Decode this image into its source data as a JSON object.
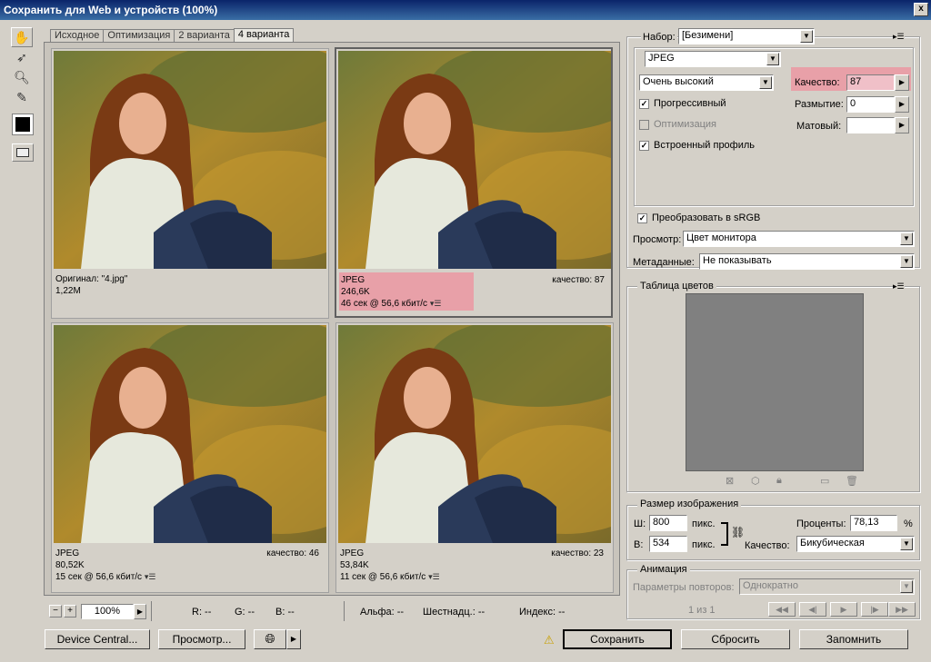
{
  "window": {
    "title": "Сохранить для Web и устройств (100%)",
    "close": "x"
  },
  "tabs": [
    "Исходное",
    "Оптимизация",
    "2 варианта",
    "4 варианта"
  ],
  "panes": [
    {
      "line1": "Оригинал: \"4.jpg\"",
      "line2": "1,22M",
      "line3": "",
      "quality": ""
    },
    {
      "line1": "JPEG",
      "line2": "246,6K",
      "line3": "46 сек @ 56,6 кбит/с",
      "quality": "качество: 87"
    },
    {
      "line1": "JPEG",
      "line2": "80,52K",
      "line3": "15 сек @ 56,6 кбит/с",
      "quality": "качество: 46"
    },
    {
      "line1": "JPEG",
      "line2": "53,84K",
      "line3": "11 сек @ 56,6 кбит/с",
      "quality": "качество: 23"
    }
  ],
  "settings": {
    "preset_label": "Набор:",
    "preset_value": "[Безимени]",
    "format": "JPEG",
    "compression": "Очень высокий",
    "quality_label": "Качество:",
    "quality_value": "87",
    "progressive": "Прогрессивный",
    "blur_label": "Размытие:",
    "blur_value": "0",
    "optimized": "Оптимизация",
    "matte_label": "Матовый:",
    "icc": "Встроенный профиль",
    "srgb": "Преобразовать в sRGB",
    "preview_label": "Просмотр:",
    "preview_value": "Цвет монитора",
    "metadata_label": "Метаданные:",
    "metadata_value": "Не показывать"
  },
  "color_table": {
    "title": "Таблица цветов"
  },
  "image_size": {
    "title": "Размер изображения",
    "w_label": "Ш:",
    "w_value": "800",
    "w_unit": "пикс.",
    "h_label": "В:",
    "h_value": "534",
    "h_unit": "пикс.",
    "percent_label": "Проценты:",
    "percent_value": "78,13",
    "percent_unit": "%",
    "quality_label": "Качество:",
    "quality_value": "Бикубическая"
  },
  "animation": {
    "title": "Анимация",
    "loop_label": "Параметры повторов:",
    "loop_value": "Однократно",
    "counter": "1 из 1"
  },
  "status": {
    "zoom": "100%",
    "r": "R: --",
    "g": "G: --",
    "b": "B: --",
    "alpha": "Альфа: --",
    "hex": "Шестнадц.: --",
    "index": "Индекс: --"
  },
  "buttons": {
    "device_central": "Device Central...",
    "preview": "Просмотр...",
    "save": "Сохранить",
    "reset": "Сбросить",
    "remember": "Запомнить"
  },
  "colors": {
    "highlight": "#e8a0a8",
    "titlebar": "#0a246a"
  }
}
